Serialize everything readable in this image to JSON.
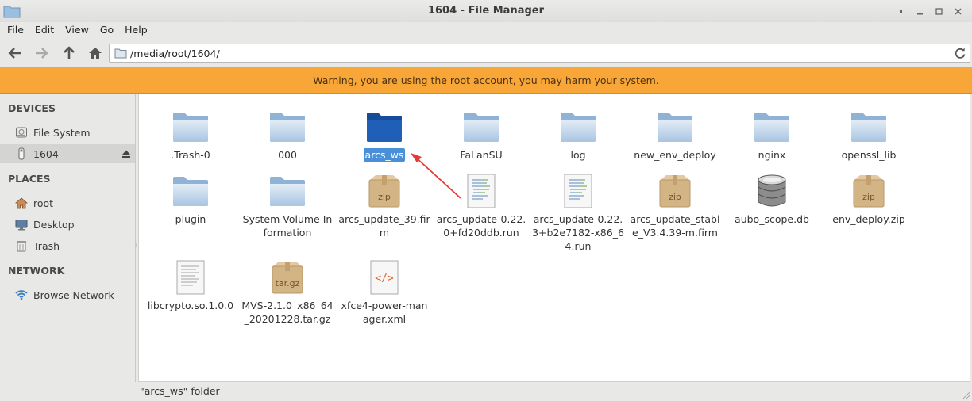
{
  "window": {
    "title": "1604 - File Manager"
  },
  "menu": [
    "File",
    "Edit",
    "View",
    "Go",
    "Help"
  ],
  "address": {
    "path": "/media/root/1604/"
  },
  "warning": "Warning, you are using the root account, you may harm your system.",
  "sidebar": {
    "devices_header": "DEVICES",
    "devices": [
      {
        "label": "File System",
        "icon": "drive-icon"
      },
      {
        "label": "1604",
        "icon": "usb-drive-icon",
        "selected": true
      }
    ],
    "places_header": "PLACES",
    "places": [
      {
        "label": "root",
        "icon": "home-icon"
      },
      {
        "label": "Desktop",
        "icon": "desktop-icon"
      },
      {
        "label": "Trash",
        "icon": "trash-icon"
      }
    ],
    "network_header": "NETWORK",
    "network": [
      {
        "label": "Browse Network",
        "icon": "wifi-icon"
      }
    ]
  },
  "files": [
    {
      "name": ".Trash-0",
      "type": "folder"
    },
    {
      "name": "000",
      "type": "folder"
    },
    {
      "name": "arcs_ws",
      "type": "folder",
      "selected": true
    },
    {
      "name": "FaLanSU",
      "type": "folder"
    },
    {
      "name": "log",
      "type": "folder"
    },
    {
      "name": "new_env_deploy",
      "type": "folder"
    },
    {
      "name": "nginx",
      "type": "folder"
    },
    {
      "name": "openssl_lib",
      "type": "folder"
    },
    {
      "name": "plugin",
      "type": "folder"
    },
    {
      "name": "System Volume Information",
      "type": "folder"
    },
    {
      "name": "arcs_update_39.firm",
      "type": "zip",
      "badge": "zip"
    },
    {
      "name": "arcs_update-0.22.0+fd20ddb.run",
      "type": "script"
    },
    {
      "name": "arcs_update-0.22.3+b2e7182-x86_64.run",
      "type": "script"
    },
    {
      "name": "arcs_update_stable_V3.4.39-m.firm",
      "type": "zip",
      "badge": "zip"
    },
    {
      "name": "aubo_scope.db",
      "type": "database"
    },
    {
      "name": "env_deploy.zip",
      "type": "zip",
      "badge": "zip"
    },
    {
      "name": "libcrypto.so.1.0.0",
      "type": "text"
    },
    {
      "name": "MVS-2.1.0_x86_64_20201228.tar.gz",
      "type": "zip",
      "badge": "tar.gz"
    },
    {
      "name": "xfce4-power-manager.xml",
      "type": "xml",
      "badge": "</>"
    }
  ],
  "status": "\"arcs_ws\" folder",
  "colors": {
    "warning": "#f8a638",
    "selection": "#4a90d9",
    "folder_selected": "#1f5fb8",
    "arrow": "#e53935"
  }
}
